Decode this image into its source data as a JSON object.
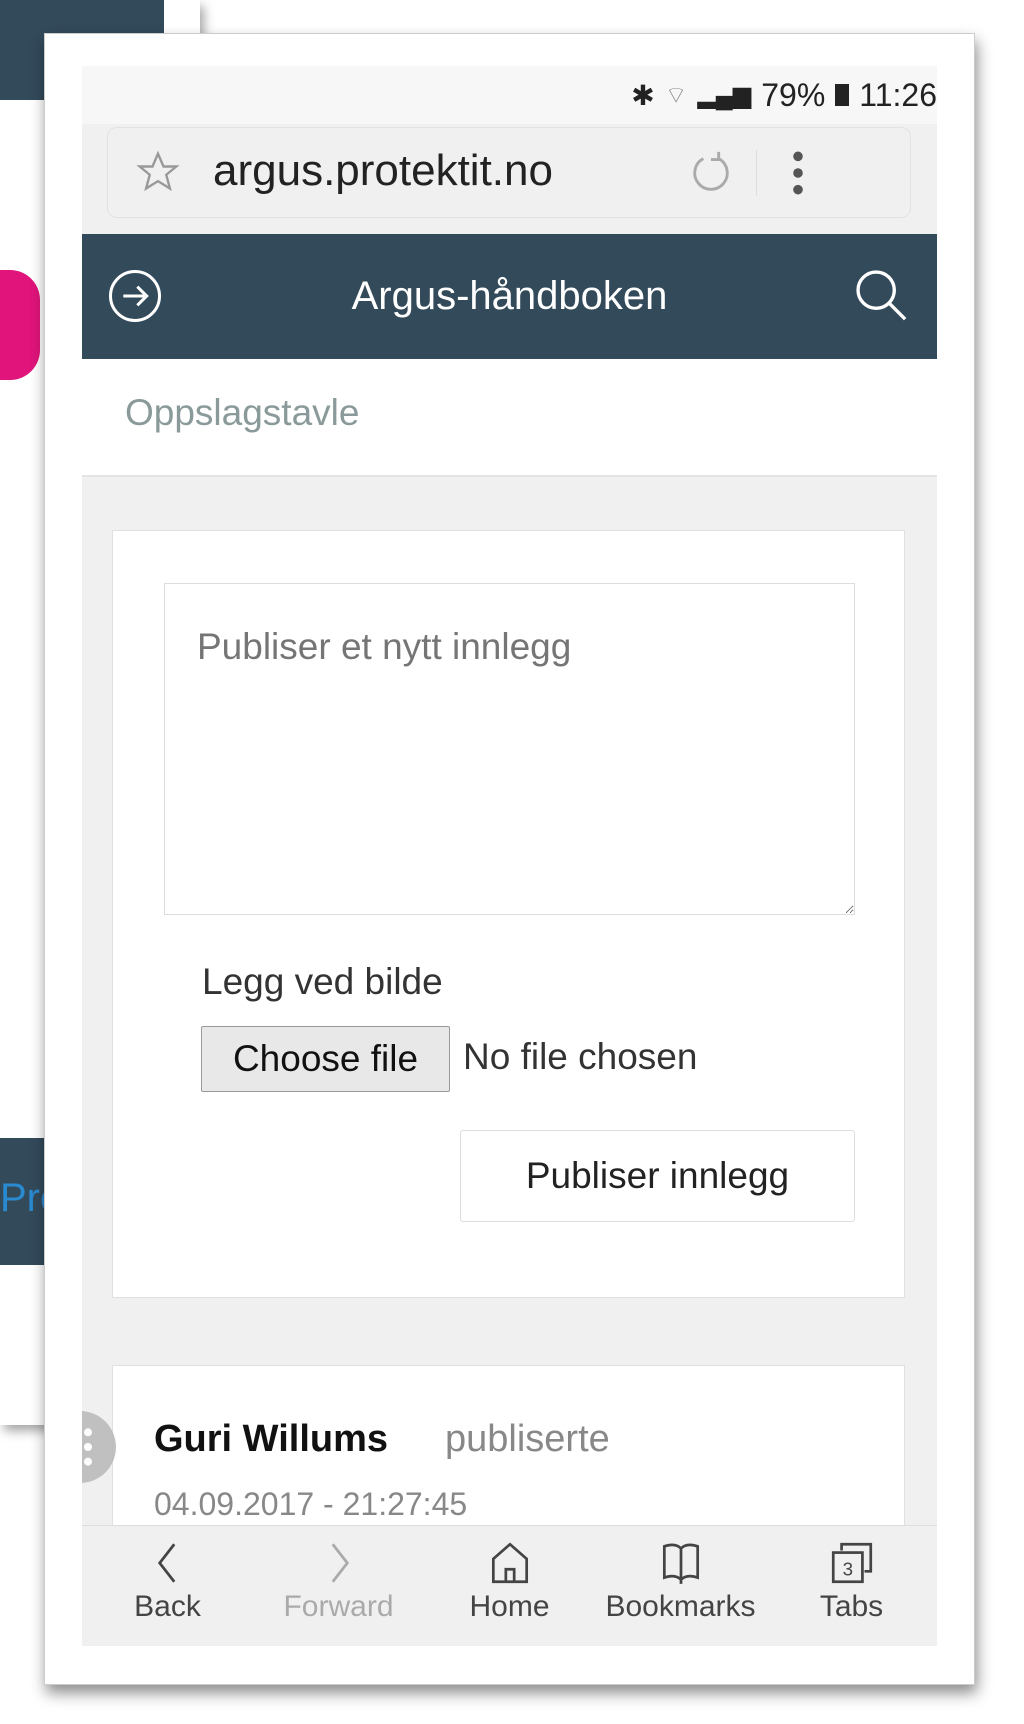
{
  "status": {
    "percent": "79%",
    "time": "11:26"
  },
  "browser": {
    "url": "argus.protektit.no"
  },
  "header": {
    "title": "Argus-håndboken"
  },
  "page": {
    "section_title": "Oppslagstavle"
  },
  "composer": {
    "placeholder": "Publiser et nytt innlegg",
    "attach_label": "Legg ved bilde",
    "choose_file": "Choose file",
    "no_file": "No file chosen",
    "publish_button": "Publiser innlegg"
  },
  "post": {
    "author": "Guri Willums",
    "action": "publiserte",
    "timestamp": "04.09.2017 - 21:27:45"
  },
  "bottom_nav": [
    {
      "label": "Back",
      "icon": "chevron-left"
    },
    {
      "label": "Forward",
      "icon": "chevron-right"
    },
    {
      "label": "Home",
      "icon": "home"
    },
    {
      "label": "Bookmarks",
      "icon": "book"
    },
    {
      "label": "Tabs",
      "icon": "tabs",
      "count": "3"
    }
  ],
  "background": {
    "partial_text": "Pro"
  },
  "colors": {
    "header": "#334a5a",
    "section_title": "#8a9a9a"
  }
}
